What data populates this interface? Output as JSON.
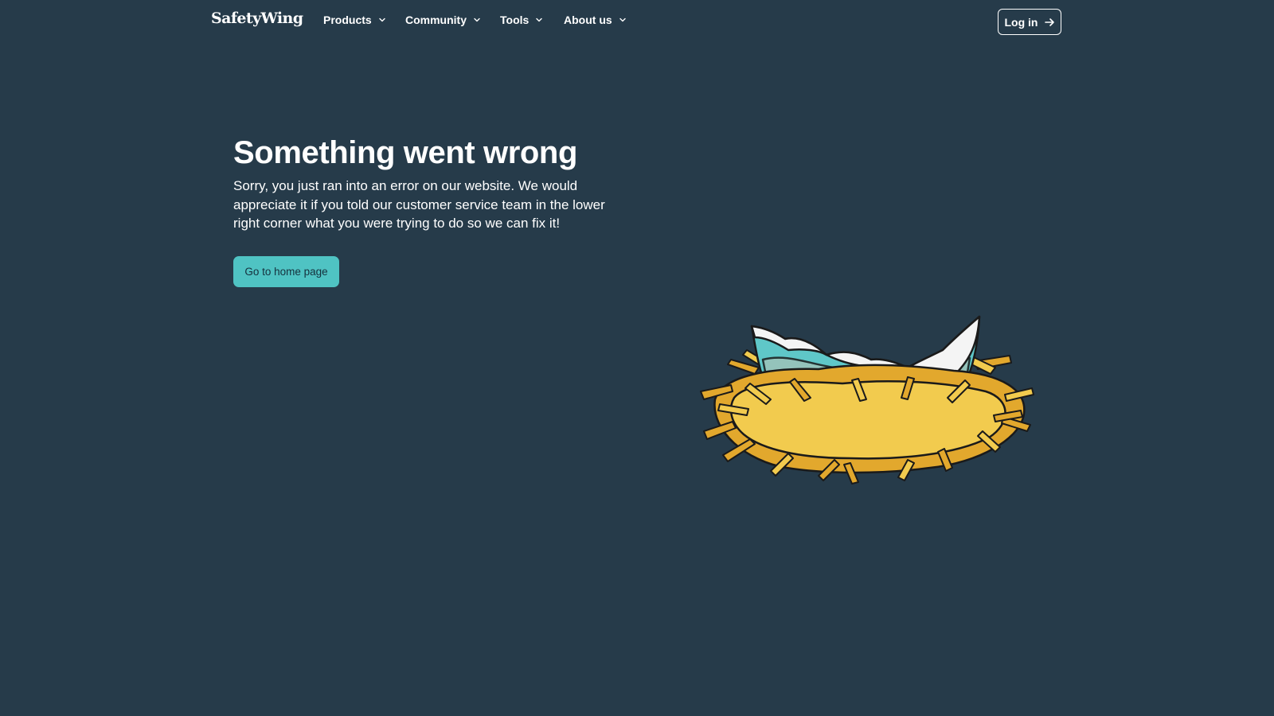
{
  "header": {
    "logo_text": "SafetyWing",
    "nav": [
      {
        "label": "Products"
      },
      {
        "label": "Community"
      },
      {
        "label": "Tools"
      },
      {
        "label": "About us"
      }
    ],
    "login_label": "Log in"
  },
  "main": {
    "title": "Something went wrong",
    "message": "Sorry, you just ran into an error on our website. We would appreciate it if you told our customer service team in the lower right corner what you were trying to do so we can fix it!",
    "home_button_label": "Go to home page"
  },
  "illustration": {
    "name": "broken-egg-nest-illustration"
  },
  "colors": {
    "background": "#263b4a",
    "accent": "#4fc3c3",
    "text": "#ffffff",
    "nest_yellow": "#f2cb4e",
    "nest_orange": "#e2a82d",
    "egg_teal": "#5fc7c8"
  }
}
